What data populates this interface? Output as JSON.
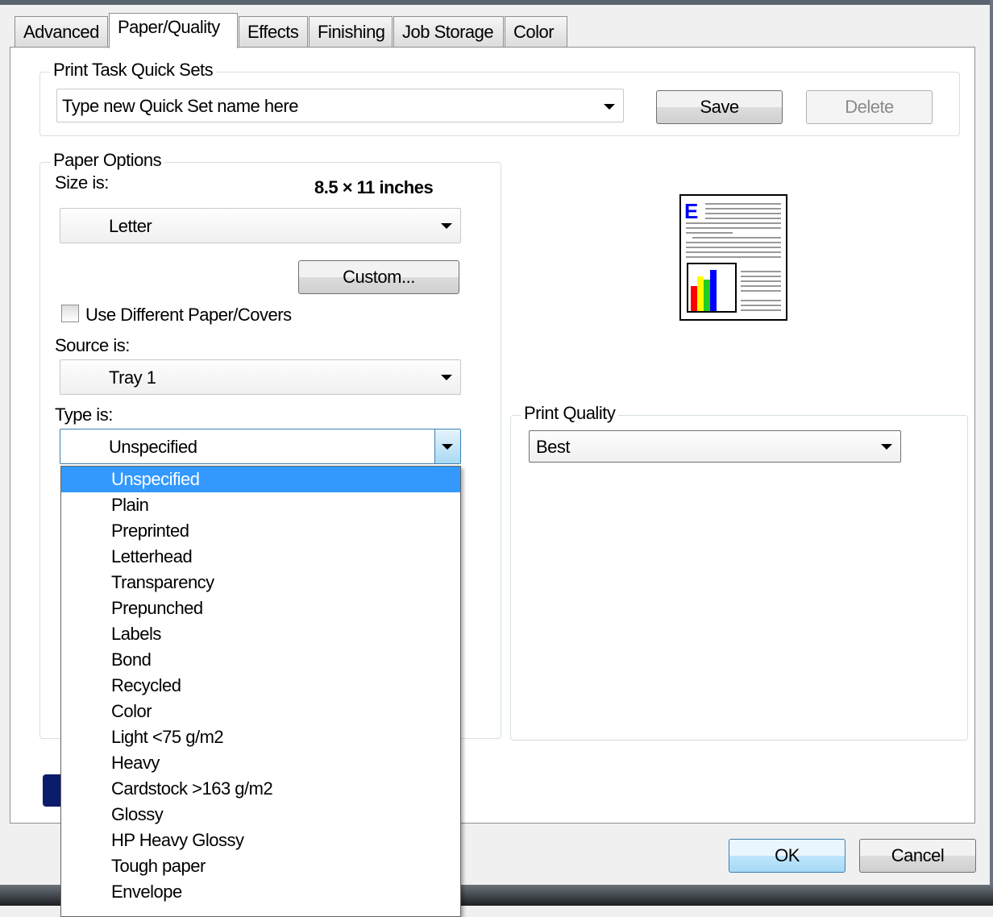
{
  "tabs": [
    {
      "label": "Advanced"
    },
    {
      "label": "Paper/Quality"
    },
    {
      "label": "Effects"
    },
    {
      "label": "Finishing"
    },
    {
      "label": "Job Storage"
    },
    {
      "label": "Color"
    }
  ],
  "active_tab": "Paper/Quality",
  "quick_sets": {
    "legend": "Print Task Quick Sets",
    "value": "Type new Quick Set name here",
    "save_label": "Save",
    "delete_label": "Delete"
  },
  "paper_options": {
    "legend": "Paper Options",
    "size_label": "Size is:",
    "size_value": "8.5 × 11 inches",
    "size_select": "Letter",
    "custom_label": "Custom...",
    "different_paper_label": "Use Different Paper/Covers",
    "different_paper_checked": false,
    "source_label": "Source is:",
    "source_select": "Tray 1",
    "type_label": "Type is:",
    "type_select": "Unspecified"
  },
  "type_options": [
    "Unspecified",
    "Plain",
    "Preprinted",
    "Letterhead",
    "Transparency",
    "Prepunched",
    "Labels",
    "Bond",
    "Recycled",
    "Color",
    "Light <75 g/m2",
    "Heavy",
    "Cardstock >163 g/m2",
    "Glossy",
    "HP Heavy Glossy",
    "Tough paper",
    "Envelope"
  ],
  "print_quality": {
    "legend": "Print Quality",
    "value": "Best"
  },
  "footer": {
    "ok_label": "OK",
    "cancel_label": "Cancel"
  },
  "colors": {
    "selection": "#3399ff",
    "preview_letter": "#0000ee"
  }
}
